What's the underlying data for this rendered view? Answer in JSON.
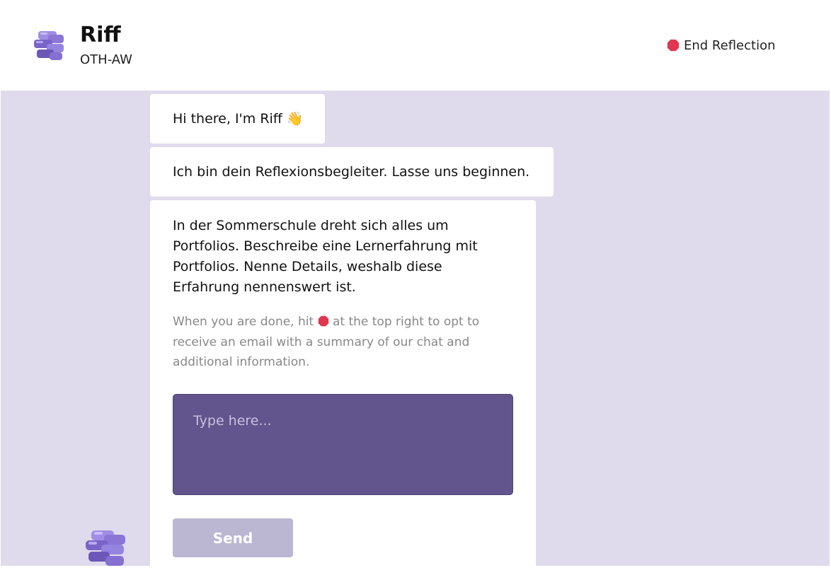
{
  "header": {
    "title": "Riff",
    "subtitle": "OTH-AW",
    "end_label": "End Reflection",
    "logo_icon": "cube-stack-logo-icon",
    "end_icon": "stop-sign-icon"
  },
  "chat": {
    "messages": [
      {
        "text": "Hi there, I'm Riff 👋"
      },
      {
        "text": "Ich bin dein Reflexionsbegleiter. Lasse uns beginnen."
      },
      {
        "text": "In der Sommerschule dreht sich alles um Portfolios. Beschreibe eine Lernerfahrung mit Portfolios. Nenne Details, weshalb diese Erfahrung nennenswert ist.",
        "hint_before": "When you are done, hit ",
        "hint_after": " at the top right to opt to receive an email with a summary of our chat and additional information."
      }
    ],
    "input_placeholder": "Type here...",
    "input_value": "",
    "send_label": "Send"
  },
  "colors": {
    "chat_background": "#e0dbec",
    "input_background": "#62548c",
    "send_button": "#bbb6d2",
    "stop_red": "#e0364f",
    "logo_purple": "#8b76d6"
  }
}
